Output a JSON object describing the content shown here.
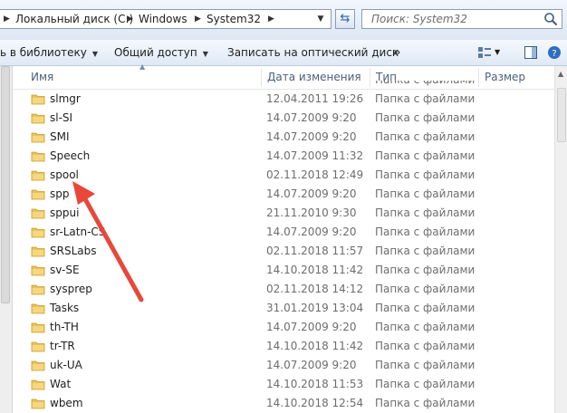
{
  "address": {
    "crumbs": [
      "Локальный диск (C:)",
      "Windows",
      "System32"
    ],
    "refresh_icon": "refresh-icon"
  },
  "search": {
    "placeholder": "Поиск: System32",
    "icon": "search-icon"
  },
  "toolbar": {
    "library_label": "ь в библиотеку",
    "share_label": "Общий доступ",
    "burn_label": "Записать на оптический диск",
    "more_label": "»"
  },
  "columns": {
    "name": "Имя",
    "date": "Дата изменения",
    "type": "Тип",
    "size": "Размер"
  },
  "partial_row": {
    "type": "Папка с файлами"
  },
  "rows": [
    {
      "name": "slmgr",
      "date": "12.04.2011 19:26",
      "type": "Папка с файлами"
    },
    {
      "name": "sl-SI",
      "date": "14.07.2009 9:20",
      "type": "Папка с файлами"
    },
    {
      "name": "SMI",
      "date": "14.07.2009 9:20",
      "type": "Папка с файлами"
    },
    {
      "name": "Speech",
      "date": "14.07.2009 11:32",
      "type": "Папка с файлами"
    },
    {
      "name": "spool",
      "date": "02.11.2018 12:49",
      "type": "Папка с файлами"
    },
    {
      "name": "spp",
      "date": "14.07.2009 9:20",
      "type": "Папка с файлами"
    },
    {
      "name": "sppui",
      "date": "21.11.2010 9:30",
      "type": "Папка с файлами"
    },
    {
      "name": "sr-Latn-CS",
      "date": "14.07.2009 9:20",
      "type": "Папка с файлами"
    },
    {
      "name": "SRSLabs",
      "date": "02.11.2018 11:57",
      "type": "Папка с файлами"
    },
    {
      "name": "sv-SE",
      "date": "14.10.2018 11:42",
      "type": "Папка с файлами"
    },
    {
      "name": "sysprep",
      "date": "02.11.2018 14:12",
      "type": "Папка с файлами"
    },
    {
      "name": "Tasks",
      "date": "31.01.2019 13:04",
      "type": "Папка с файлами"
    },
    {
      "name": "th-TH",
      "date": "14.07.2009 9:20",
      "type": "Папка с файлами"
    },
    {
      "name": "tr-TR",
      "date": "14.10.2018 11:42",
      "type": "Папка с файлами"
    },
    {
      "name": "uk-UA",
      "date": "14.07.2009 9:20",
      "type": "Папка с файлами"
    },
    {
      "name": "Wat",
      "date": "14.10.2018 11:53",
      "type": "Папка с файлами"
    },
    {
      "name": "wbem",
      "date": "14.10.2018 12:54",
      "type": "Папка с файлами"
    }
  ],
  "annotation": {
    "color": "#e8473a",
    "points_to": "spool"
  }
}
